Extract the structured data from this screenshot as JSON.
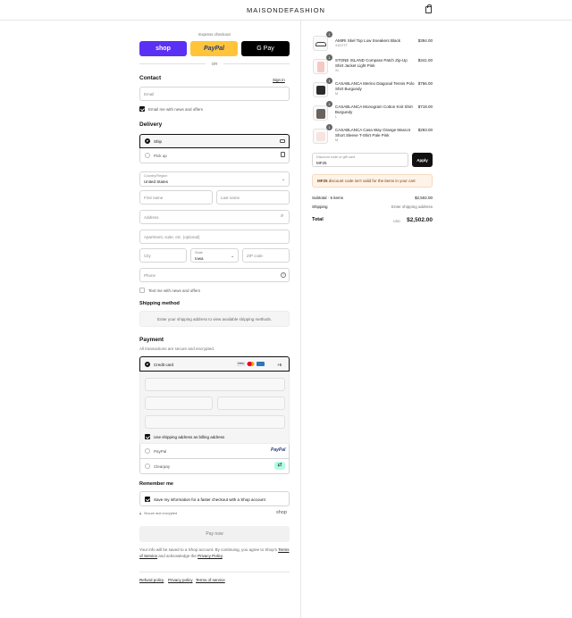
{
  "brand": "MAISONDEFASHION",
  "express": {
    "title": "Express checkout",
    "shop": "shop",
    "paypal": "PayPal",
    "gpay": "G Pay",
    "or": "OR"
  },
  "contact": {
    "heading": "Contact",
    "sign_in": "Sign in",
    "email_placeholder": "Email",
    "news_label": "Email me with news and offers"
  },
  "delivery": {
    "heading": "Delivery",
    "ship": "Ship",
    "pickup": "Pick up",
    "country_label": "Country/Region",
    "country_value": "United States",
    "first_name": "First name",
    "last_name": "Last name",
    "address": "Address",
    "apartment": "Apartment, suite, etc. (optional)",
    "city": "City",
    "state_label": "State",
    "state_value": "Iowa",
    "zip": "ZIP code",
    "phone": "Phone",
    "text_label": "Text me with news and offers"
  },
  "shipping": {
    "heading": "Shipping method",
    "placeholder": "Enter your shipping address to view available shipping methods."
  },
  "payment": {
    "heading": "Payment",
    "secure": "All transactions are secure and encrypted.",
    "credit_card": "Credit card",
    "more_cards": "+5",
    "billing_same": "Use shipping address as billing address",
    "paypal": "PayPal",
    "paypal_logo": "PayPal",
    "clearpay": "Clearpay"
  },
  "remember": {
    "heading": "Remember me",
    "label": "Save my information for a faster checkout with a Shop account",
    "secure": "Secure and encrypted",
    "shop": "shop"
  },
  "pay_now": "Pay now",
  "legal": {
    "prefix": "Your info will be saved to a Shop account. By continuing, you agree to Shop's",
    "terms": "Terms of Service",
    "mid": "and acknowledge the",
    "privacy": "Privacy Policy",
    "end": "."
  },
  "footer_links": [
    "Refund policy",
    "Privacy policy",
    "Terms of service"
  ],
  "cart": {
    "items": [
      {
        "qty": "1",
        "name": "AMIRI Skel Top Low Sneakers Black",
        "variant": "41EXTT",
        "price": "$394.00"
      },
      {
        "qty": "1",
        "name": "STONE ISLAND Compass Patch Zip-Up Shirt Jacket Light Pink",
        "variant": "XL",
        "price": "$341.00"
      },
      {
        "qty": "1",
        "name": "CASABLANCA Merino Diagonal Tennis Polo Shirt Burgundy",
        "variant": "M",
        "price": "$766.00"
      },
      {
        "qty": "1",
        "name": "CASABLANCA Monogram Cotton Knit Shirt Burgundy",
        "variant": "L",
        "price": "$718.00"
      },
      {
        "qty": "1",
        "name": "CASABLANCA Casa Way Orange Mascot Short Sleeve T-Shirt Pale Pink",
        "variant": "M",
        "price": "$283.00"
      }
    ],
    "discount_label": "Discount code or gift card",
    "discount_value": "MF25",
    "apply": "Apply",
    "warning_code": "MF25",
    "warning_text": "discount code isn't valid for the items in your cart",
    "subtotal_label": "Subtotal · 5 items",
    "subtotal_value": "$2,502.00",
    "shipping_label": "Shipping",
    "shipping_value": "Enter shipping address",
    "total_label": "Total",
    "currency": "USD",
    "total_value": "$2,502.00"
  },
  "colors": {
    "shop": "#5a31f4",
    "paypal": "#ffc439",
    "gpay": "#000000",
    "warning_bg": "#fff3e8"
  }
}
